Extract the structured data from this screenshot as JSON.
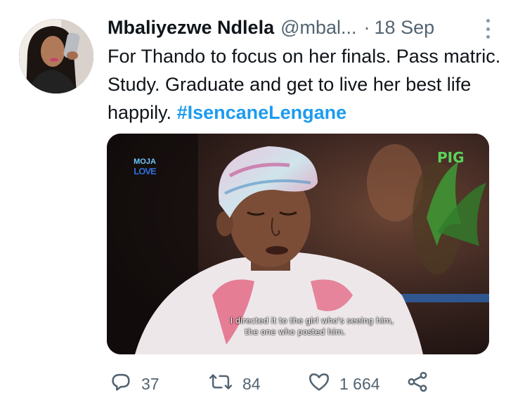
{
  "tweet": {
    "author_name": "Mbaliyezwe Ndlela",
    "handle": "@mbal...",
    "separator": "·",
    "date": "18 Sep",
    "text_before": "For Thando to focus on her finals. Pass matric. Study. Graduate and get to live her best life happily. ",
    "hashtag": "#IsencaneLengane"
  },
  "media": {
    "channel_logo_top": "MOJA",
    "channel_logo_bottom": "LOVE",
    "rating": "PIG",
    "subtitle_line1": "I directed it to the girl who's seeing him,",
    "subtitle_line2": "the one who posted him."
  },
  "actions": {
    "replies": "37",
    "retweets": "84",
    "likes": "1 664"
  },
  "icons": {
    "more": "more-dots-icon",
    "reply": "reply-icon",
    "retweet": "retweet-icon",
    "like": "heart-icon",
    "share": "share-icon"
  },
  "colors": {
    "hashtag": "#1d9bf0",
    "secondary_text": "#536471",
    "rating_green": "#5ad35a"
  }
}
